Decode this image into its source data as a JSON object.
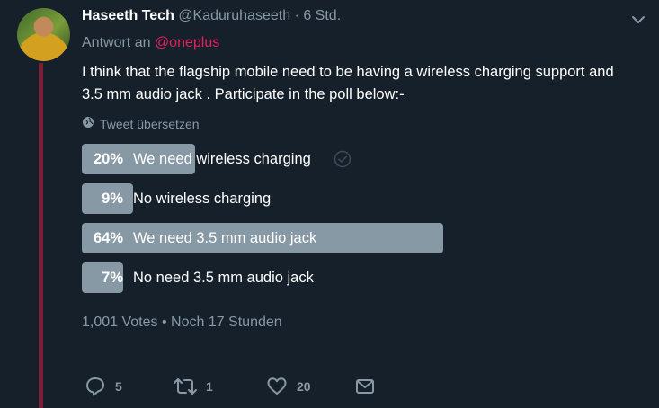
{
  "tweet": {
    "display_name": "Haseeth Tech",
    "handle": "@Kaduruhaseeth",
    "separator": "·",
    "time": "6 Std.",
    "reply_prefix": "Antwort an",
    "reply_mention": "@oneplus",
    "text": "I think that the flagship mobile need to be having a wireless charging support and 3.5 mm audio jack . Participate in the poll below:-",
    "translate_label": "Tweet übersetzen"
  },
  "poll": {
    "options": [
      {
        "percent_label": "20%",
        "label": "We need wireless charging",
        "percent": 20,
        "selected": true
      },
      {
        "percent_label": "9%",
        "label": "No wireless charging",
        "percent": 9,
        "selected": false
      },
      {
        "percent_label": "64%",
        "label": "We need 3.5 mm audio jack",
        "percent": 64,
        "selected": false
      },
      {
        "percent_label": "7%",
        "label": "No need 3.5 mm audio jack",
        "percent": 7,
        "selected": false
      }
    ],
    "meta": "1,001 Votes • Noch 17 Stunden"
  },
  "actions": {
    "reply_count": "5",
    "retweet_count": "1",
    "like_count": "20"
  },
  "icons": [
    "chevron-down-icon",
    "globe-icon",
    "check-circle-icon",
    "reply-icon",
    "retweet-icon",
    "like-icon",
    "dm-icon"
  ],
  "colors": {
    "background": "#15202b",
    "muted": "#8899a6",
    "mention": "#e0245e",
    "thread_line": "#7a1f37",
    "poll_bar": "#8899a6"
  }
}
